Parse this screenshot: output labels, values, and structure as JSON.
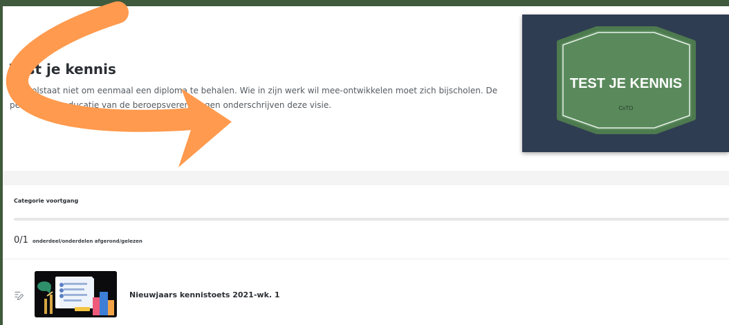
{
  "header": {
    "title": "Test je kennis",
    "description": "Het volstaat niet om eenmaal een diploma te behalen. Wie in zijn werk wil mee-ontwikkelen moet zich bijscholen. De permanente educatie van de beroepsverenigingen onderschrijven deze visie."
  },
  "badge": {
    "title": "TEST JE KENNIS",
    "subtitle": "CvTO"
  },
  "progress": {
    "heading": "Categorie voortgang",
    "count": "0/1",
    "label": "onderdeel/onderdelen afgerond/gelezen",
    "fraction": 0
  },
  "lessons": [
    {
      "title": "Nieuwjaars kennistoets 2021-wk. 1",
      "icon": "edit-document-icon"
    }
  ],
  "colors": {
    "frame": "#3f5a3c",
    "badge_background": "#2f3d52",
    "badge_green": "#5a8a5c",
    "badge_border": "#4d7a4f",
    "arrow": "#ff9a4e"
  }
}
